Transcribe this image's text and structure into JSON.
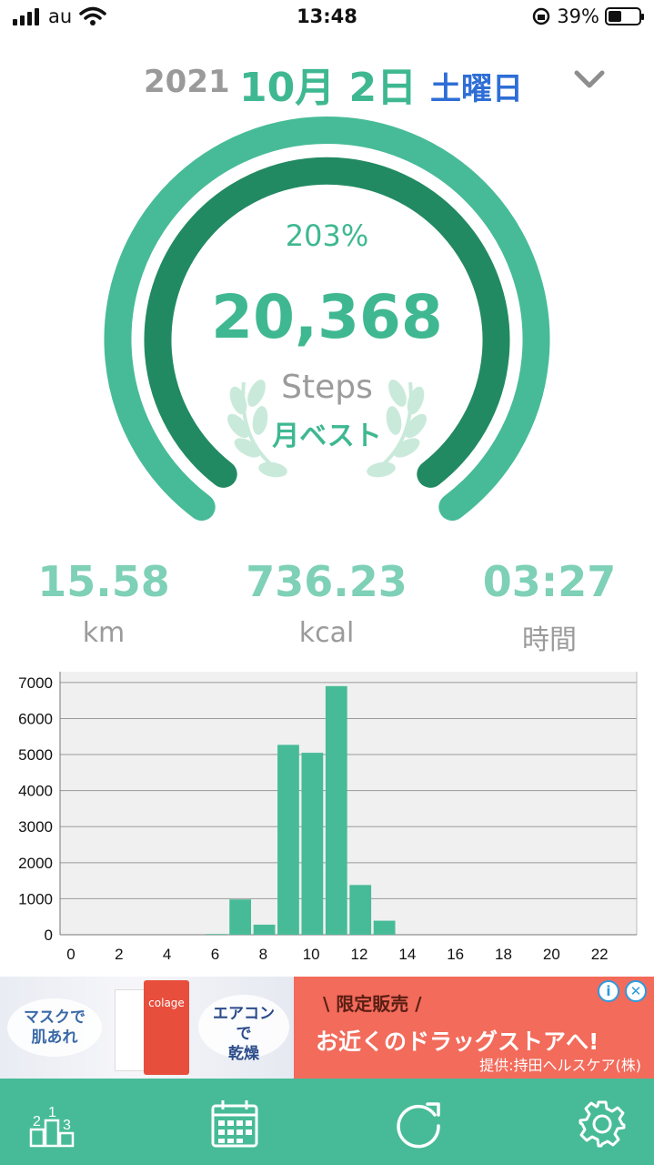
{
  "status_bar": {
    "carrier": "au",
    "time": "13:48",
    "battery_percent": "39%",
    "icons": [
      "signal-icon",
      "wifi-icon",
      "rotation-lock-icon",
      "battery-icon"
    ]
  },
  "date_header": {
    "year": "2021",
    "month_day": "10月 2日",
    "weekday": "土曜日",
    "dropdown_icon": "chevron-down-icon"
  },
  "summary": {
    "percent": "203%",
    "steps": "20,368",
    "steps_unit": "Steps",
    "badge": "月ベスト",
    "goal_progress": 2.03
  },
  "stats": [
    {
      "value": "15.58",
      "unit": "km"
    },
    {
      "value": "736.23",
      "unit": "kcal"
    },
    {
      "value": "03:27",
      "unit": "時間"
    }
  ],
  "chart_data": {
    "type": "bar",
    "x": [
      6,
      7,
      8,
      9,
      10,
      11,
      12,
      13
    ],
    "values": [
      20,
      980,
      280,
      5270,
      5050,
      6900,
      1380,
      390
    ],
    "xlim": [
      0,
      24
    ],
    "ylim": [
      0,
      7300
    ],
    "x_ticks": [
      "0",
      "2",
      "4",
      "6",
      "8",
      "10",
      "12",
      "14",
      "16",
      "18",
      "20",
      "22"
    ],
    "y_ticks": [
      "0",
      "1000",
      "2000",
      "3000",
      "4000",
      "5000",
      "6000",
      "7000"
    ],
    "grid": true,
    "bar_color": "#47bb97"
  },
  "ad": {
    "left_pill_1": "マスクで\n肌あれ",
    "left_pill_2": "エアコンで\n乾燥",
    "headline_top": "\\ 限定販売 /",
    "headline": "お近くのドラッグストアへ!",
    "sponsor": "提供:持田ヘルスケア(株)",
    "brand": "colage"
  },
  "tab_bar": {
    "tabs": [
      {
        "name": "ranking",
        "icon": "ranking-icon"
      },
      {
        "name": "calendar",
        "icon": "calendar-icon"
      },
      {
        "name": "refresh",
        "icon": "refresh-icon"
      },
      {
        "name": "settings",
        "icon": "gear-icon"
      }
    ]
  },
  "colors": {
    "accent": "#3fb891",
    "ring_outer": "#47bb97",
    "ring_inner": "#228a62",
    "weekday": "#2e6ed6",
    "tab_bar": "#47bb97"
  }
}
